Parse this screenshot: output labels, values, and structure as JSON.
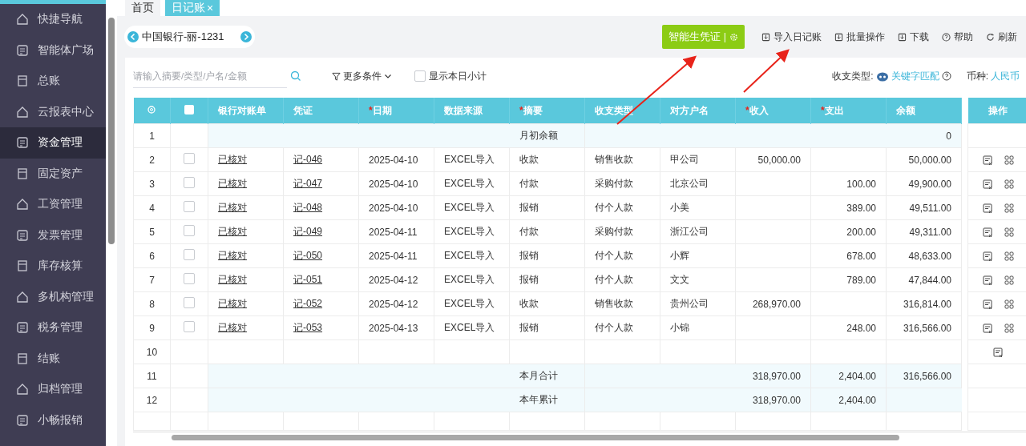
{
  "sidebar": {
    "items": [
      {
        "label": "快捷导航",
        "selected": false
      },
      {
        "label": "智能体广场",
        "selected": false
      },
      {
        "label": "总账",
        "selected": false
      },
      {
        "label": "云报表中心",
        "selected": false
      },
      {
        "label": "资金管理",
        "selected": true
      },
      {
        "label": "固定资产",
        "selected": false
      },
      {
        "label": "工资管理",
        "selected": false
      },
      {
        "label": "发票管理",
        "selected": false
      },
      {
        "label": "库存核算",
        "selected": false
      },
      {
        "label": "多机构管理",
        "selected": false
      },
      {
        "label": "税务管理",
        "selected": false
      },
      {
        "label": "结账",
        "selected": false
      },
      {
        "label": "归档管理",
        "selected": false
      },
      {
        "label": "小畅报销",
        "selected": false
      }
    ]
  },
  "tabs": [
    {
      "label": "首页",
      "selected": false
    },
    {
      "label": "日记账",
      "selected": true,
      "close": "×"
    }
  ],
  "account": {
    "name": "中国银行-丽-1231"
  },
  "toolbar": [
    {
      "kind": "primary",
      "label": "智能生凭证",
      "separator": "|"
    },
    {
      "kind": "tool",
      "label": "导入日记账"
    },
    {
      "kind": "tool",
      "label": "批量操作"
    },
    {
      "kind": "tool",
      "label": "下载"
    },
    {
      "kind": "tool",
      "label": "帮助"
    },
    {
      "kind": "tool",
      "label": "刷新"
    }
  ],
  "filters": {
    "search": {
      "placeholder": "请输入摘要/类型/户名/金额"
    },
    "more": "更多条件",
    "daily_subtotal": {
      "label": "显示本日小计",
      "checked": false
    },
    "type_label": "收支类型:",
    "type_link": "关键字匹配",
    "currency_label": "币种:",
    "currency": "人民币"
  },
  "table": {
    "select_all_checked": false,
    "columns": [
      {
        "label": "银行对账单"
      },
      {
        "label": "凭证"
      },
      {
        "label": "日期",
        "required_mark": "*"
      },
      {
        "label": "数据来源"
      },
      {
        "label": "摘要",
        "required_mark": "*"
      },
      {
        "label": "收支类型"
      },
      {
        "label": "对方户名"
      },
      {
        "label": "收入",
        "required_mark": "*"
      },
      {
        "label": "支出",
        "required_mark": "*"
      },
      {
        "label": "余额"
      }
    ],
    "ops_heading": "操作",
    "rows": [
      {
        "kind": "summary",
        "index": "1",
        "label": "月初余额",
        "balance": "0"
      },
      {
        "kind": "entry",
        "index": "2",
        "checked": false,
        "bank": "已核对",
        "voucher": "记-046",
        "date": "2025-04-10",
        "source": "EXCEL导入",
        "summary": "收款",
        "type": "销售收款",
        "party": "甲公司",
        "income": "50,000.00",
        "balance": "50,000.00"
      },
      {
        "kind": "entry",
        "index": "3",
        "checked": false,
        "bank": "已核对",
        "voucher": "记-047",
        "date": "2025-04-10",
        "source": "EXCEL导入",
        "summary": "付款",
        "type": "采购付款",
        "party": "北京公司",
        "expense": "100.00",
        "balance": "49,900.00"
      },
      {
        "kind": "entry",
        "index": "4",
        "checked": false,
        "bank": "已核对",
        "voucher": "记-048",
        "date": "2025-04-10",
        "source": "EXCEL导入",
        "summary": "报销",
        "type": "付个人款",
        "party": "小美",
        "expense": "389.00",
        "balance": "49,511.00"
      },
      {
        "kind": "entry",
        "index": "5",
        "checked": false,
        "bank": "已核对",
        "voucher": "记-049",
        "date": "2025-04-11",
        "source": "EXCEL导入",
        "summary": "付款",
        "type": "采购付款",
        "party": "浙江公司",
        "expense": "200.00",
        "balance": "49,311.00"
      },
      {
        "kind": "entry",
        "index": "6",
        "checked": false,
        "bank": "已核对",
        "voucher": "记-050",
        "date": "2025-04-11",
        "source": "EXCEL导入",
        "summary": "报销",
        "type": "付个人款",
        "party": "小辉",
        "expense": "678.00",
        "balance": "48,633.00"
      },
      {
        "kind": "entry",
        "index": "7",
        "checked": false,
        "bank": "已核对",
        "voucher": "记-051",
        "date": "2025-04-12",
        "source": "EXCEL导入",
        "summary": "报销",
        "type": "付个人款",
        "party": "文文",
        "expense": "789.00",
        "balance": "47,844.00"
      },
      {
        "kind": "entry",
        "index": "8",
        "checked": false,
        "bank": "已核对",
        "voucher": "记-052",
        "date": "2025-04-12",
        "source": "EXCEL导入",
        "summary": "收款",
        "type": "销售收款",
        "party": "贵州公司",
        "income": "268,970.00",
        "balance": "316,814.00"
      },
      {
        "kind": "entry",
        "index": "9",
        "checked": false,
        "bank": "已核对",
        "voucher": "记-053",
        "date": "2025-04-13",
        "source": "EXCEL导入",
        "summary": "报销",
        "type": "付个人款",
        "party": "小锦",
        "expense": "248.00",
        "balance": "316,566.00"
      },
      {
        "kind": "blank",
        "index": "10"
      },
      {
        "kind": "summary",
        "index": "11",
        "label": "本月合计",
        "income": "318,970.00",
        "expense": "2,404.00",
        "balance": "316,566.00"
      },
      {
        "kind": "summary",
        "index": "12",
        "label": "本年累计",
        "income": "318,970.00",
        "expense": "2,404.00"
      }
    ]
  }
}
